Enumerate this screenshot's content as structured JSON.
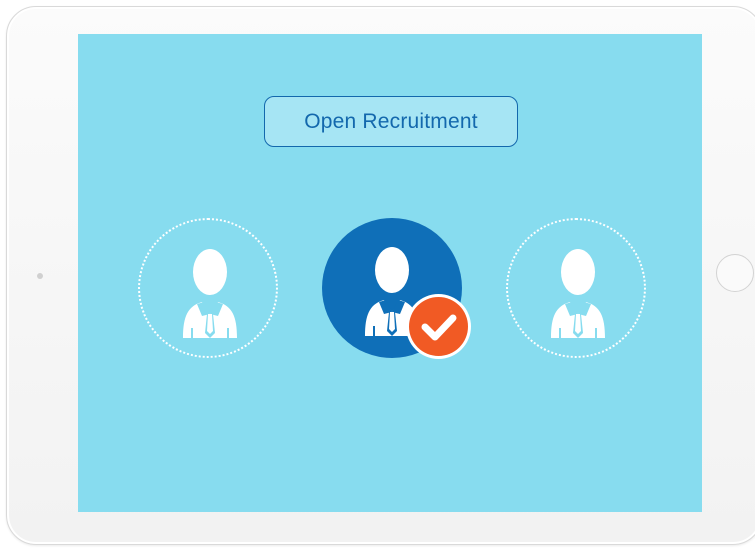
{
  "screen": {
    "title": "Open Recruitment",
    "background_color": "#87dcef",
    "accent_color": "#1368ad",
    "selected_color": "#0f6fb8",
    "check_color": "#f15a24"
  },
  "candidates": [
    {
      "icon": "person-icon",
      "state": "unselected"
    },
    {
      "icon": "person-icon",
      "state": "selected"
    },
    {
      "icon": "person-icon",
      "state": "unselected"
    }
  ],
  "badge": {
    "icon": "checkmark-icon"
  }
}
